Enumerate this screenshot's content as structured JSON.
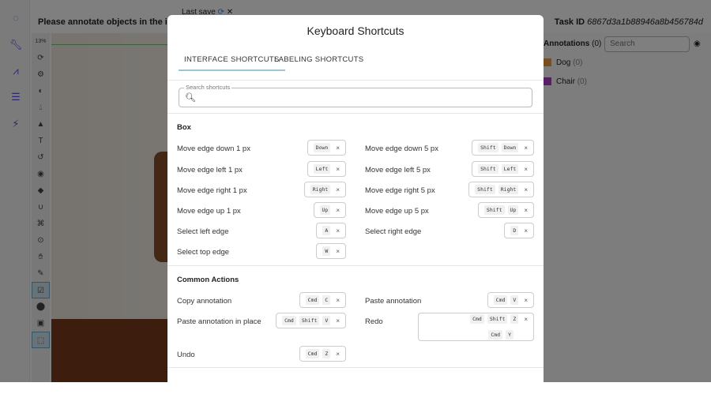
{
  "header": {
    "instruction": "Please annotate objects in the image.",
    "last_save": "Last save",
    "task_id_label": "Task ID",
    "task_id": "6867d3a1b88946a8b456784d"
  },
  "tools": {
    "zoom": "13%"
  },
  "right_panel": {
    "annotations_label": "Annotations",
    "annotations_count": "(0)",
    "search_placeholder": "Search",
    "labels": [
      {
        "name": "Dog",
        "count": "(0)",
        "color": "#f0a040"
      },
      {
        "name": "Chair",
        "count": "(0)",
        "color": "#b040c8"
      }
    ]
  },
  "modal": {
    "title": "Keyboard Shortcuts",
    "tabs": [
      "INTERFACE SHORTCUTS",
      "LABELING SHORTCUTS"
    ],
    "search_label": "Search shortcuts",
    "sections": [
      {
        "title": "Box",
        "rows": [
          [
            {
              "label": "Move edge down 1 px",
              "keys": [
                [
                  "Down"
                ]
              ]
            },
            {
              "label": "Move edge down 5 px",
              "keys": [
                [
                  "Shift",
                  "Down"
                ]
              ]
            }
          ],
          [
            {
              "label": "Move edge left 1 px",
              "keys": [
                [
                  "Left"
                ]
              ]
            },
            {
              "label": "Move edge left 5 px",
              "keys": [
                [
                  "Shift",
                  "Left"
                ]
              ]
            }
          ],
          [
            {
              "label": "Move edge right 1 px",
              "keys": [
                [
                  "Right"
                ]
              ]
            },
            {
              "label": "Move edge right 5 px",
              "keys": [
                [
                  "Shift",
                  "Right"
                ]
              ]
            }
          ],
          [
            {
              "label": "Move edge up 1 px",
              "keys": [
                [
                  "Up"
                ]
              ]
            },
            {
              "label": "Move edge up 5 px",
              "keys": [
                [
                  "Shift",
                  "Up"
                ]
              ]
            }
          ],
          [
            {
              "label": "Select left edge",
              "keys": [
                [
                  "A"
                ]
              ]
            },
            {
              "label": "Select right edge",
              "keys": [
                [
                  "D"
                ]
              ]
            }
          ],
          [
            {
              "label": "Select top edge",
              "keys": [
                [
                  "W"
                ]
              ]
            }
          ]
        ]
      },
      {
        "title": "Common Actions",
        "rows": [
          [
            {
              "label": "Copy annotation",
              "keys": [
                [
                  "Cmd",
                  "C"
                ]
              ]
            },
            {
              "label": "Paste annotation",
              "keys": [
                [
                  "Cmd",
                  "V"
                ]
              ]
            }
          ],
          [
            {
              "label": "Paste annotation in place",
              "keys": [
                [
                  "Cmd",
                  "Shift",
                  "V"
                ]
              ]
            },
            {
              "label": "Redo",
              "keys": [
                [
                  "Cmd",
                  "Shift",
                  "Z"
                ],
                [
                  "Cmd",
                  "Y"
                ]
              ]
            }
          ],
          [
            {
              "label": "Undo",
              "keys": [
                [
                  "Cmd",
                  "Z"
                ]
              ]
            }
          ]
        ]
      }
    ]
  }
}
